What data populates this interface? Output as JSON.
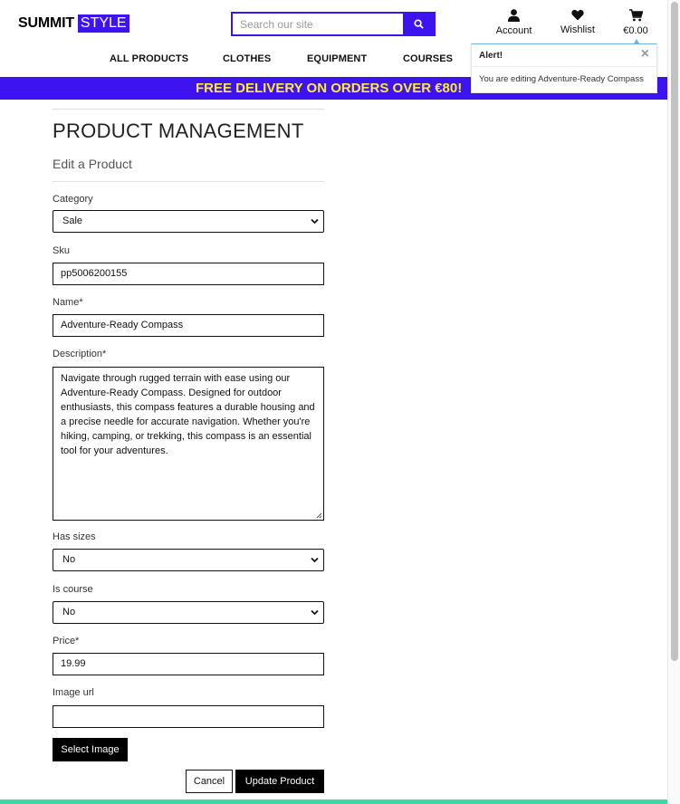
{
  "brand": {
    "part1": "SUMMIT",
    "part2": "STYLE",
    "accent": "#3d14f0"
  },
  "search": {
    "placeholder": "Search our site",
    "value": ""
  },
  "header_icons": {
    "account": {
      "label": "Account",
      "icon": "user-icon"
    },
    "wishlist": {
      "label": "Wishlist",
      "icon": "heart-icon"
    },
    "bag": {
      "label": "€0.00",
      "icon": "cart-icon"
    }
  },
  "nav": {
    "items": [
      "ALL PRODUCTS",
      "CLOTHES",
      "EQUIPMENT",
      "COURSES"
    ]
  },
  "banner": {
    "text": "FREE DELIVERY ON ORDERS OVER €80!",
    "text_color": "#ffea3a"
  },
  "toast": {
    "title": "Alert!",
    "message": "You are editing Adventure-Ready Compass",
    "close": "×"
  },
  "page": {
    "title": "PRODUCT MANAGEMENT",
    "subtitle": "Edit a Product"
  },
  "form": {
    "category": {
      "label": "Category",
      "value": "Sale"
    },
    "sku": {
      "label": "Sku",
      "value": "pp5006200155"
    },
    "name": {
      "label": "Name*",
      "value": "Adventure-Ready Compass"
    },
    "description": {
      "label": "Description*",
      "value": "Navigate through rugged terrain with ease using our Adventure-Ready Compass. Designed for outdoor enthusiasts, this compass features a durable housing and a precise needle for accurate navigation. Whether you're hiking, camping, or trekking, this compass is an essential tool for your adventures."
    },
    "has_sizes": {
      "label": "Has sizes",
      "value": "No"
    },
    "is_course": {
      "label": "Is course",
      "value": "No"
    },
    "price": {
      "label": "Price*",
      "value": "19.99"
    },
    "image_url": {
      "label": "Image url",
      "value": ""
    },
    "select_image_label": "Select Image",
    "cancel_label": "Cancel",
    "update_label": "Update Product"
  }
}
